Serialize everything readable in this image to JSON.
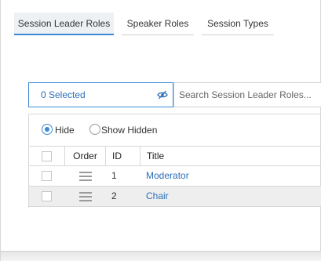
{
  "tabs": [
    {
      "label": "Session Leader Roles",
      "active": true
    },
    {
      "label": "Speaker Roles",
      "active": false
    },
    {
      "label": "Session Types",
      "active": false
    }
  ],
  "filter": {
    "selected_label": "0 Selected",
    "search_placeholder": "Search Session Leader Roles..."
  },
  "visibility": {
    "hide_label": "Hide",
    "show_hidden_label": "Show Hidden",
    "selected": "hide"
  },
  "table": {
    "columns": [
      "Order",
      "ID",
      "Title"
    ],
    "rows": [
      {
        "id": "1",
        "title": "Moderator"
      },
      {
        "id": "2",
        "title": "Chair"
      }
    ]
  },
  "colors": {
    "accent": "#3b8ad6",
    "link": "#2b6fb6",
    "alt_row": "#eeeeee"
  }
}
